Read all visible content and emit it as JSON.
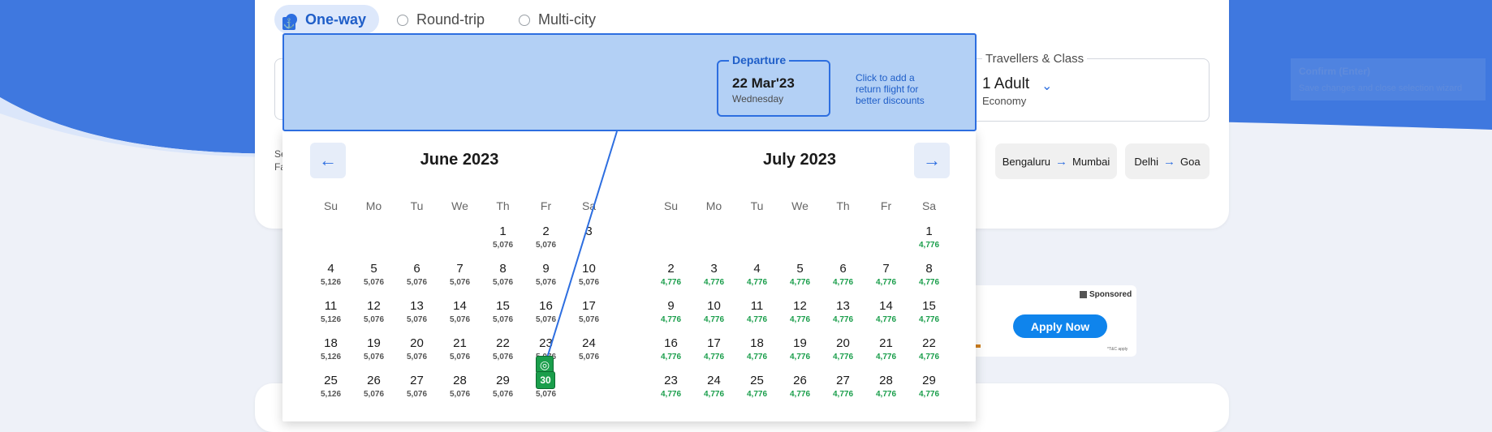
{
  "trip_types": [
    {
      "label": "One-way",
      "selected": true
    },
    {
      "label": "Round-trip",
      "selected": false
    },
    {
      "label": "Multi-city",
      "selected": false
    }
  ],
  "travellers": {
    "label": "Travellers & Class",
    "value": "1 Adult",
    "class": "Economy"
  },
  "special_fares_partial": {
    "line1": "Se",
    "line2": "Fa"
  },
  "route_chips": [
    {
      "from": "Bengaluru",
      "to": "Mumbai"
    },
    {
      "from": "Delhi",
      "to": "Goa"
    }
  ],
  "ad": {
    "sponsored": "Sponsored",
    "cta": "Apply Now",
    "fine": "*T&C apply"
  },
  "toast": {
    "title": "Confirm (Enter)",
    "subtitle": "Save changes and close selection wizard"
  },
  "overlay": {
    "departure_label": "Departure",
    "departure_date": "22 Mar'23",
    "departure_day": "Wednesday",
    "return_hint": "Click to add a return flight for better discounts"
  },
  "calendar": {
    "weekdays": [
      "Su",
      "Mo",
      "Tu",
      "We",
      "Th",
      "Fr",
      "Sa"
    ],
    "months": [
      {
        "title": "June 2023",
        "lead_blanks": 4,
        "days": [
          {
            "d": "1",
            "p": "5,076"
          },
          {
            "d": "2",
            "p": "5,076"
          },
          {
            "d": "3",
            "p": ""
          },
          {
            "d": "4",
            "p": "5,126"
          },
          {
            "d": "5",
            "p": "5,076"
          },
          {
            "d": "6",
            "p": "5,076"
          },
          {
            "d": "7",
            "p": "5,076"
          },
          {
            "d": "8",
            "p": "5,076"
          },
          {
            "d": "9",
            "p": "5,076"
          },
          {
            "d": "10",
            "p": "5,076"
          },
          {
            "d": "11",
            "p": "5,126"
          },
          {
            "d": "12",
            "p": "5,076"
          },
          {
            "d": "13",
            "p": "5,076"
          },
          {
            "d": "14",
            "p": "5,076"
          },
          {
            "d": "15",
            "p": "5,076"
          },
          {
            "d": "16",
            "p": "5,076"
          },
          {
            "d": "17",
            "p": "5,076"
          },
          {
            "d": "18",
            "p": "5,126"
          },
          {
            "d": "19",
            "p": "5,076"
          },
          {
            "d": "20",
            "p": "5,076"
          },
          {
            "d": "21",
            "p": "5,076"
          },
          {
            "d": "22",
            "p": "5,076"
          },
          {
            "d": "23",
            "p": "5,076"
          },
          {
            "d": "24",
            "p": "5,076"
          },
          {
            "d": "25",
            "p": "5,126"
          },
          {
            "d": "26",
            "p": "5,076"
          },
          {
            "d": "27",
            "p": "5,076"
          },
          {
            "d": "28",
            "p": "5,076"
          },
          {
            "d": "29",
            "p": "5,076"
          },
          {
            "d": "30",
            "p": "5,076"
          }
        ]
      },
      {
        "title": "July 2023",
        "lead_blanks": 6,
        "days": [
          {
            "d": "1",
            "p": "4,776"
          },
          {
            "d": "2",
            "p": "4,776"
          },
          {
            "d": "3",
            "p": "4,776"
          },
          {
            "d": "4",
            "p": "4,776"
          },
          {
            "d": "5",
            "p": "4,776"
          },
          {
            "d": "6",
            "p": "4,776"
          },
          {
            "d": "7",
            "p": "4,776"
          },
          {
            "d": "8",
            "p": "4,776"
          },
          {
            "d": "9",
            "p": "4,776"
          },
          {
            "d": "10",
            "p": "4,776"
          },
          {
            "d": "11",
            "p": "4,776"
          },
          {
            "d": "12",
            "p": "4,776"
          },
          {
            "d": "13",
            "p": "4,776"
          },
          {
            "d": "14",
            "p": "4,776"
          },
          {
            "d": "15",
            "p": "4,776"
          },
          {
            "d": "16",
            "p": "4,776"
          },
          {
            "d": "17",
            "p": "4,776"
          },
          {
            "d": "18",
            "p": "4,776"
          },
          {
            "d": "19",
            "p": "4,776"
          },
          {
            "d": "20",
            "p": "4,776"
          },
          {
            "d": "21",
            "p": "4,776"
          },
          {
            "d": "22",
            "p": "4,776"
          },
          {
            "d": "23",
            "p": "4,776"
          },
          {
            "d": "24",
            "p": "4,776"
          },
          {
            "d": "25",
            "p": "4,776"
          },
          {
            "d": "26",
            "p": "4,776"
          },
          {
            "d": "27",
            "p": "4,776"
          },
          {
            "d": "28",
            "p": "4,776"
          },
          {
            "d": "29",
            "p": "4,776"
          }
        ]
      }
    ]
  },
  "colors": {
    "accent": "#2d6ee0",
    "low_price": "#1a9e4b",
    "overlay_fill": "#b3d0f5"
  }
}
